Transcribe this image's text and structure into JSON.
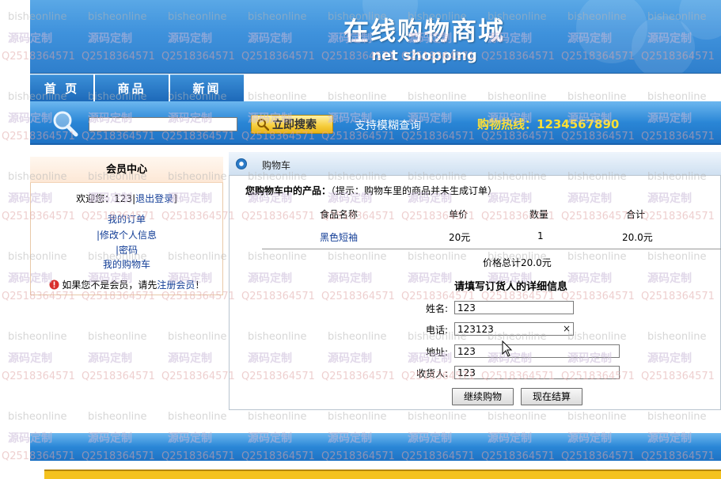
{
  "banner": {
    "title": "在线购物商城",
    "subtitle": "net shopping"
  },
  "nav": [
    {
      "label": "首 页"
    },
    {
      "label": "商品"
    },
    {
      "label": "新闻"
    }
  ],
  "search": {
    "value": "",
    "button_label": "立即搜索",
    "fuzzy_text": "支持模糊查询",
    "hotline": "购物热线：1234567890"
  },
  "member": {
    "header": "会员中心",
    "welcome_prefix": "欢迎您：",
    "username": "123",
    "logout": "退出登录",
    "logout_open": "|",
    "logout_close": "]",
    "my_orders": "我的订单",
    "edit_info": "|修改个人信息",
    "password": "|密码",
    "my_cart": "我的购物车",
    "not_member_prefix": "如果您不是会员，请先",
    "register": "注册会员",
    "not_member_suffix": "！"
  },
  "cart": {
    "header": "购物车",
    "heading_bold": "您购物车中的产品：",
    "heading_hint": "（提示：购物车里的商品并未生成订单）",
    "columns": [
      "食品名称",
      "单价",
      "数量",
      "合计"
    ],
    "rows": [
      {
        "name": "黑色短袖",
        "price": "20元",
        "qty": "1",
        "total": "20.0元"
      }
    ],
    "total_label": "价格总计20.0元",
    "fill_title": "请填写订货人的详细信息",
    "fields": {
      "name_label": "姓名:",
      "name_value": "123",
      "phone_label": "电话:",
      "phone_value": "123123",
      "address_label": "地址:",
      "address_value": "123",
      "receiver_label": "收货人:",
      "receiver_value": "123"
    },
    "continue_button": "继续购物",
    "checkout_button": "现在结算",
    "clear_glyph": "×"
  },
  "watermark": {
    "line_a": "bisheonline",
    "line_b": "源码定制",
    "line_c": "Q2518364571"
  },
  "colors": {
    "banner_blue": "#3f92dc",
    "hotline_yellow": "#ffe033",
    "link_blue": "#123d96",
    "footer_yellow": "#f4c21f"
  }
}
